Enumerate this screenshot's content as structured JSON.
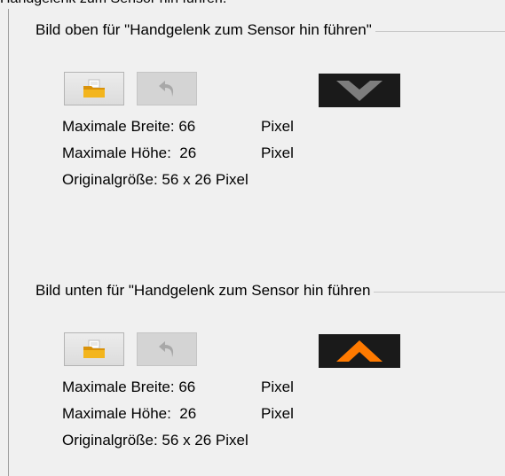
{
  "top_cut_text": "Handgelenk zum Sensor hin führen.",
  "groups": [
    {
      "title": "Bild oben für \"Handgelenk zum Sensor hin führen\"",
      "open_icon": "folder-open-icon",
      "undo_icon": "undo-arrow-icon",
      "preview_icon": "chevron-down-icon",
      "preview_color": "#7d7d7d",
      "max_width_label": "Maximale Breite: 66",
      "max_width_unit": "Pixel",
      "max_height_label": "Maximale Höhe:  26",
      "max_height_unit": "Pixel",
      "original_size": "Originalgröße: 56 x 26 Pixel"
    },
    {
      "title": "Bild unten für \"Handgelenk zum Sensor hin führen",
      "open_icon": "folder-open-icon",
      "undo_icon": "undo-arrow-icon",
      "preview_icon": "chevron-up-icon",
      "preview_color": "#ff7a00",
      "max_width_label": "Maximale Breite: 66",
      "max_width_unit": "Pixel",
      "max_height_label": "Maximale Höhe:  26",
      "max_height_unit": "Pixel",
      "original_size": "Originalgröße: 56 x 26 Pixel"
    }
  ]
}
